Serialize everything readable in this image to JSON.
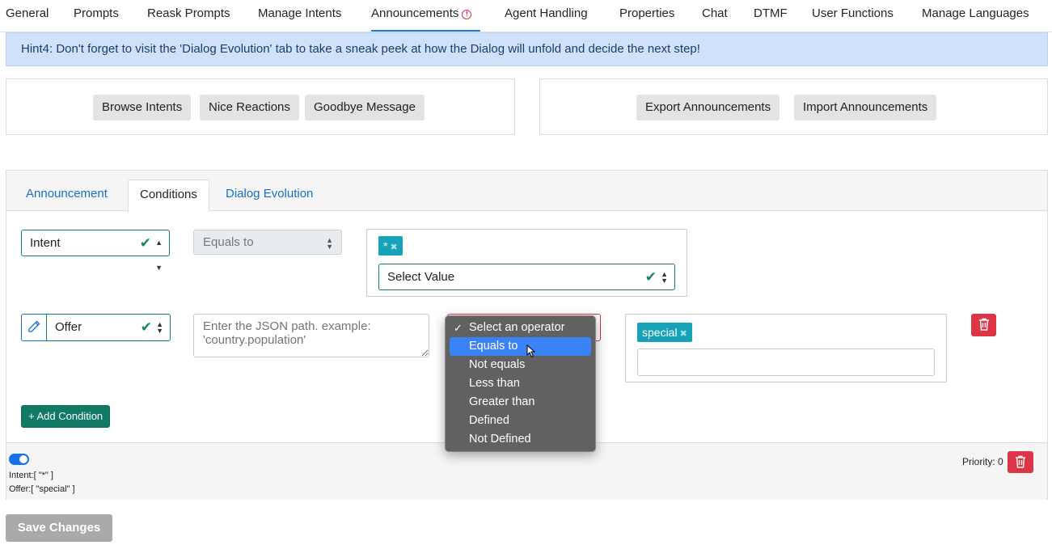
{
  "topnav": {
    "tabs": [
      {
        "label": "General"
      },
      {
        "label": "Prompts"
      },
      {
        "label": "Reask Prompts"
      },
      {
        "label": "Manage Intents"
      },
      {
        "label": "Announcements"
      },
      {
        "label": "Agent Handling"
      },
      {
        "label": "Properties"
      },
      {
        "label": "Chat"
      },
      {
        "label": "DTMF"
      },
      {
        "label": "User Functions"
      },
      {
        "label": "Manage Languages"
      }
    ],
    "active": "Announcements",
    "warning_icon": "!"
  },
  "hint": {
    "text": "Hint4: Don't forget to visit the 'Dialog Evolution' tab to take a sneak peek at how the Dialog will unfold and decide the next step!"
  },
  "left_panel": {
    "buttons": [
      "Browse Intents",
      "Nice Reactions",
      "Goodbye Message"
    ]
  },
  "right_panel": {
    "buttons": [
      "Export Announcements",
      "Import Announcements"
    ]
  },
  "card": {
    "tabs": [
      "Announcement",
      "Conditions",
      "Dialog Evolution"
    ],
    "active_tab": "Conditions"
  },
  "condition1": {
    "field": "Intent",
    "operator": "Equals to",
    "tags": [
      "*"
    ],
    "value_select": "Select Value"
  },
  "condition2": {
    "field": "Offer",
    "json_path_placeholder": "Enter the JSON path. example: 'country.population'",
    "tags": [
      "special"
    ],
    "value_input": ""
  },
  "operator_dropdown": {
    "options": [
      "Select an operator",
      "Equals to",
      "Not equals",
      "Less than",
      "Greater than",
      "Defined",
      "Not Defined"
    ],
    "checked": "Select an operator",
    "highlighted": "Equals to"
  },
  "add_condition_label": "+ Add Condition",
  "summary": {
    "enabled": true,
    "lines": [
      "Intent:[ \"*\" ]",
      "Offer:[ \"special\" ]"
    ],
    "priority_label": "Priority: 0"
  },
  "save_label": "Save Changes",
  "colors": {
    "accent": "#1b7fd1",
    "teal": "#0f7d67",
    "tag": "#17a2b8",
    "danger": "#dc3545",
    "hint_bg": "#cfe2fa"
  }
}
